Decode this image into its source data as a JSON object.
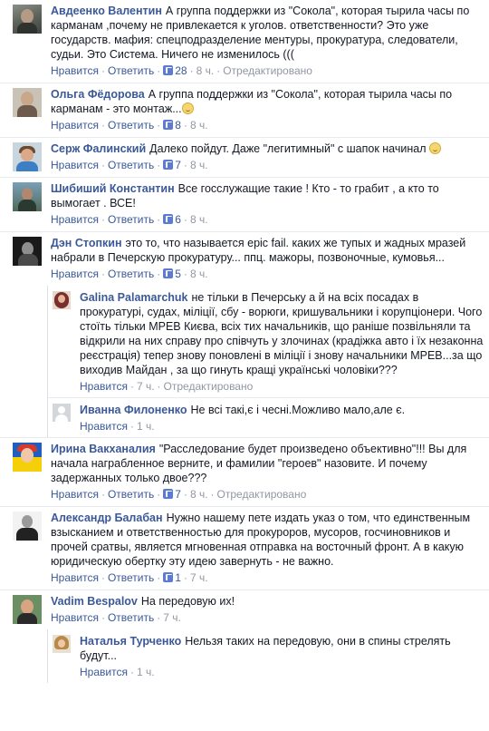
{
  "ui": {
    "like": "Нравится",
    "reply": "Ответить",
    "edited": "Отредактировано",
    "separator": "·"
  },
  "comments": [
    {
      "author": "Авдеенко Валентин",
      "text": "А группа поддержки из \"Сокола\", которая тырила часы по карманам ,почему не привлекается к уголов. ответственности? Это уже государств. мафия: спецподразделение ментуры, прокуратура, следователи, судьи. Это Система. Ничего не изменилось (((",
      "likes": "28",
      "time": "8 ч.",
      "edited": true,
      "avatar_icon": "avatar-man-dark"
    },
    {
      "author": "Ольга Фёдорова",
      "text": "А группа поддержки из \"Сокола\", которая тырила часы по карманам - это монтаж...",
      "emoji": "smile-icon",
      "likes": "8",
      "time": "8 ч.",
      "edited": false,
      "avatar_icon": "avatar-woman"
    },
    {
      "author": "Серж Фалинский",
      "text": "Далеко пойдут. Даже \"легитимный\" с шапок начинал",
      "emoji": "smile-icon",
      "likes": "7",
      "time": "8 ч.",
      "edited": false,
      "avatar_icon": "avatar-man-blue"
    },
    {
      "author": "Шибиший Константин",
      "text": "Все госслужащие такие ! Кто - то грабит , а кто то вымогает . ВСЕ!",
      "likes": "6",
      "time": "8 ч.",
      "edited": false,
      "avatar_icon": "avatar-man-outdoor"
    },
    {
      "author": "Дэн Стопкин",
      "text": "это то, что называется epic fail. каких же тупых и жадных мразей набрали в Печерскую прокуратуру... ппц. мажоры, позвоночные, кумовья...",
      "likes": "5",
      "time": "8 ч.",
      "edited": false,
      "avatar_icon": "avatar-man-bw"
    },
    {
      "author": "Galina Palamarchuk",
      "text": "не тільки в Печерську а й на всіх посадах в прокуратурі, судах, міліції, сбу - ворюги, кришувальники і корупціонери. Чого стоїть тільки МРЕВ Києва, всіх тих начальників, що раніше позвільняли та відкрили на них справу про співчуть у злочинах (крадіжка авто і їх незаконна реєстрація) тепер знову поновлені в міліції і знову начальники МРЕВ...за що виходив Майдан , за що гинуть кращі українські чоловіки???",
      "likes": "",
      "time": "7 ч.",
      "edited": true,
      "reply": true,
      "avatar_icon": "avatar-woman-red"
    },
    {
      "author": "Иванна Филоненко",
      "text": "Не всі такі,є і чесні.Можливо мало,але є.",
      "likes": "",
      "time": "1 ч.",
      "edited": false,
      "reply": true,
      "avatar_icon": "avatar-default"
    },
    {
      "author": "Ирина Вакханалия",
      "text": "\"Расследование будет произведено объективно\"!!! Вы для начала награбленное верните, и фамилии \"героев\" назовите. И почему задержанных только двое???",
      "likes": "7",
      "time": "8 ч.",
      "edited": true,
      "avatar_icon": "avatar-ukraine"
    },
    {
      "author": "Александр Балабан",
      "text": "Нужно нашему пете издать указ о том, что единственным взысканием и ответственностью для прокуроров, мусоров, госчиновников и прочей сратвы, является мгновенная отправка на восточный фронт. А в какую юридическую обертку эту идею завернуть - не важно.",
      "likes": "1",
      "time": "7 ч.",
      "edited": false,
      "avatar_icon": "avatar-man-suit"
    },
    {
      "author": "Vadim Bespalov",
      "text": "На передовую их!",
      "likes": "",
      "time": "7 ч.",
      "edited": false,
      "avatar_icon": "avatar-man-green"
    },
    {
      "author": "Наталья Турченко",
      "text": "Нельзя таких на передовую, они в спины стрелять будут...",
      "likes": "",
      "time": "1 ч.",
      "edited": false,
      "reply": true,
      "avatar_icon": "avatar-woman-blonde"
    }
  ]
}
